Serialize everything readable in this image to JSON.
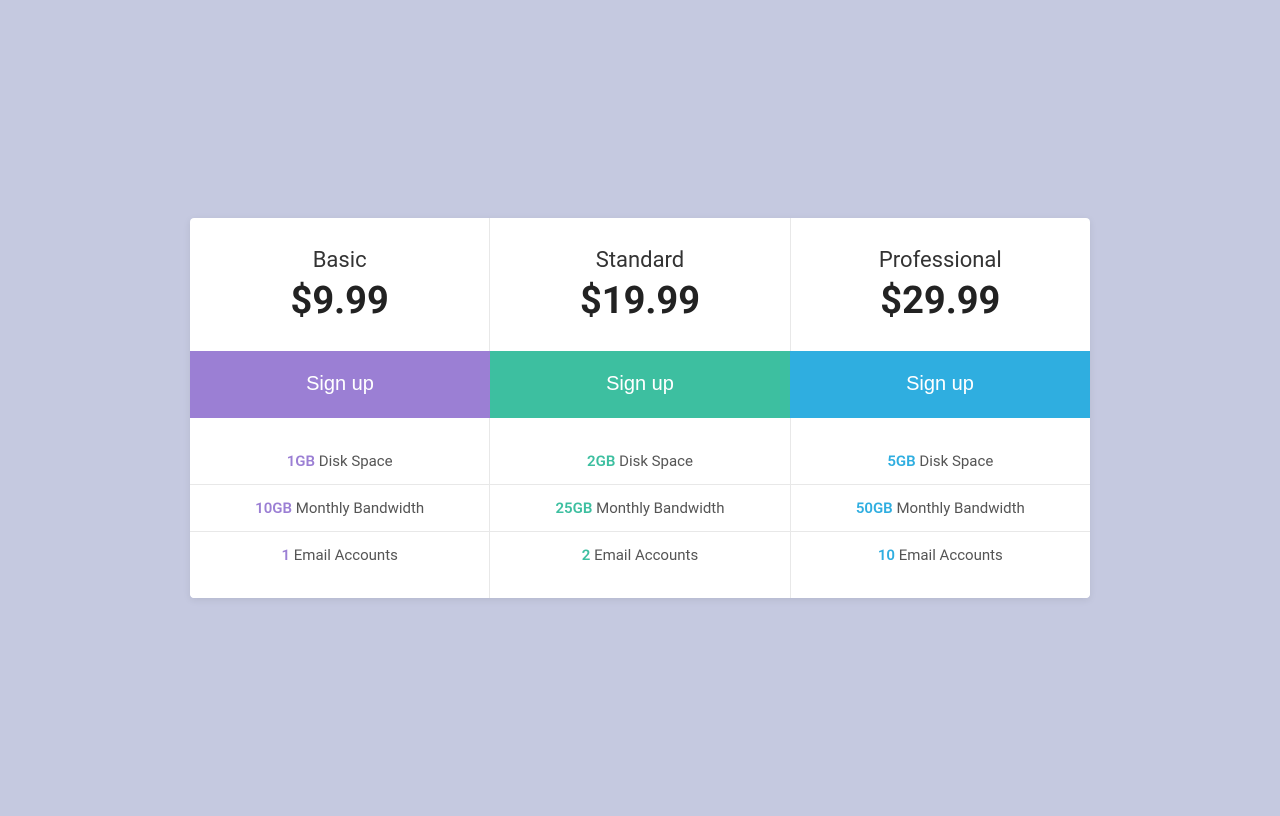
{
  "plans": [
    {
      "id": "basic",
      "name": "Basic",
      "price": "$9.99",
      "signup_label": "Sign up",
      "highlight_color": "purple",
      "features": [
        {
          "highlight": "1GB",
          "text": " Disk Space"
        },
        {
          "highlight": "10GB",
          "text": " Monthly Bandwidth"
        },
        {
          "highlight": "1",
          "text": " Email Accounts"
        }
      ]
    },
    {
      "id": "standard",
      "name": "Standard",
      "price": "$19.99",
      "signup_label": "Sign up",
      "highlight_color": "teal",
      "features": [
        {
          "highlight": "2GB",
          "text": " Disk Space"
        },
        {
          "highlight": "25GB",
          "text": " Monthly Bandwidth"
        },
        {
          "highlight": "2",
          "text": " Email Accounts"
        }
      ]
    },
    {
      "id": "professional",
      "name": "Professional",
      "price": "$29.99",
      "signup_label": "Sign up",
      "highlight_color": "blue",
      "features": [
        {
          "highlight": "5GB",
          "text": " Disk Space"
        },
        {
          "highlight": "50GB",
          "text": " Monthly Bandwidth"
        },
        {
          "highlight": "10",
          "text": " Email Accounts"
        }
      ]
    }
  ]
}
